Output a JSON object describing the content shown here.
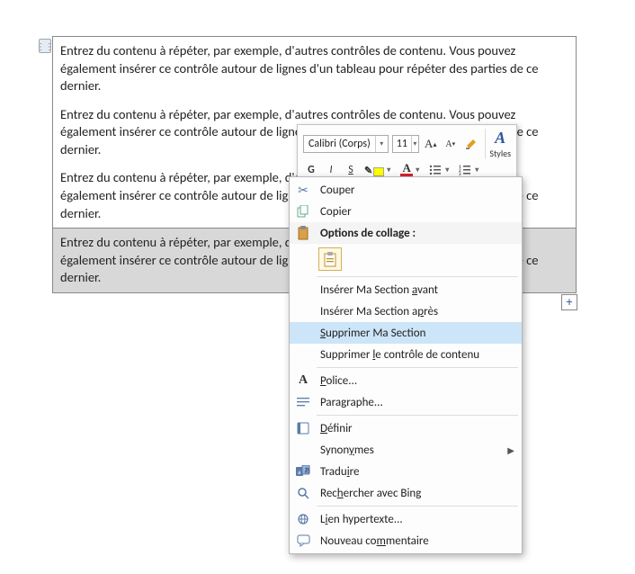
{
  "doc": {
    "sections": [
      "Entrez du contenu à répéter, par exemple, d'autres contrôles de contenu. Vous pouvez également insérer ce contrôle autour de lignes d'un tableau pour répéter des parties de ce dernier.",
      "Entrez du contenu à répéter, par exemple, d'autres contrôles de contenu. Vous pouvez également insérer ce contrôle autour de lignes d'un tableau pour répéter des parties de ce dernier.",
      "Entrez du contenu à répéter, par exemple, d'autres contrôles de contenu. Vous pouvez également insérer ce contrôle autour de lignes d'un tableau pour répéter des parties de ce dernier.",
      "Entrez du contenu à répéter, par exemple, d'autres contrôles de contenu. Vous pouvez également insérer ce contrôle autour de lignes d'un tableau pour répéter des parties de ce dernier."
    ],
    "add_symbol": "+"
  },
  "toolbar": {
    "font_name": "Calibri (Corps)",
    "font_size": "11",
    "grow": "A",
    "shrink": "A",
    "styles_label": "Styles",
    "bold": "G",
    "italic": "I",
    "underline": "S",
    "font_color_letter": "A"
  },
  "menu": {
    "cut": "Couper",
    "copy": "Copier",
    "paste_header": "Options de collage :",
    "insert_before_pre": "Insérer Ma Section ",
    "insert_before_u": "a",
    "insert_before_post": "vant",
    "insert_after_pre": "Insérer Ma Section a",
    "insert_after_u": "p",
    "insert_after_post": "rès",
    "delete_section_u": "S",
    "delete_section_post": "upprimer Ma Section",
    "delete_control_pre": "Supprimer ",
    "delete_control_u": "l",
    "delete_control_post": "e contrôle de contenu",
    "font_u": "P",
    "font_post": "olice...",
    "paragraph_pre": "Para",
    "paragraph_u": "g",
    "paragraph_post": "raphe...",
    "define_u": "D",
    "define_post": "éfinir",
    "synonyms_pre": "Synon",
    "synonyms_u": "y",
    "synonyms_post": "mes",
    "translate_pre": "Tradu",
    "translate_u": "i",
    "translate_post": "re",
    "bing_pre": "Rec",
    "bing_u": "h",
    "bing_post": "ercher avec Bing",
    "hyperlink_pre": "L",
    "hyperlink_u": "i",
    "hyperlink_post": "en hypertexte...",
    "comment_pre": "Nouveau co",
    "comment_u": "m",
    "comment_post": "mentaire"
  }
}
